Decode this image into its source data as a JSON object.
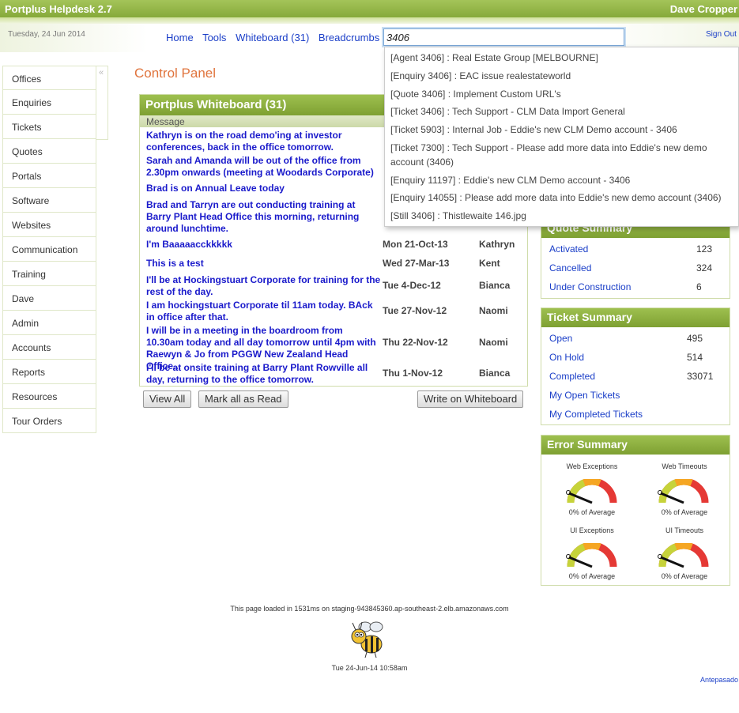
{
  "app": {
    "title": "Portplus Helpdesk 2.7",
    "user": "Dave Cropper",
    "date": "Tuesday, 24 Jun 2014",
    "sign_out": "Sign Out"
  },
  "nav": {
    "home": "Home",
    "tools": "Tools",
    "whiteboard": "Whiteboard (31)",
    "breadcrumbs": "Breadcrumbs"
  },
  "search": {
    "value": "3406"
  },
  "dropdown": [
    "[Agent 3406] : Real Estate Group [MELBOURNE]",
    "[Enquiry 3406] : EAC issue realestateworld",
    "[Quote 3406] : Implement Custom URL's",
    "[Ticket 3406] : Tech Support - CLM Data Import General",
    "[Ticket 5903] : Internal Job - Eddie's new CLM Demo account - 3406",
    "[Ticket 7300] : Tech Support - Please add more data into Eddie's new demo account (3406)",
    "[Enquiry 11197] : Eddie's new CLM Demo account - 3406",
    "[Enquiry 14055] : Please add more data into Eddie's new demo account (3406)",
    "[Still 3406] : Thistlewaite 146.jpg"
  ],
  "sidebar": [
    "Offices",
    "Enquiries",
    "Tickets",
    "Quotes",
    "Portals",
    "Software",
    "Websites",
    "Communication",
    "Training",
    "Dave",
    "Admin",
    "Accounts",
    "Reports",
    "Resources",
    "Tour Orders"
  ],
  "sidebar_toggle": "«",
  "control_panel_title": "Control Panel",
  "whiteboard": {
    "title": "Portplus Whiteboard (31)",
    "col_message": "Message",
    "rows": [
      {
        "msg": "Kathryn is on the road demo'ing at investor conferences, back in the office tomorrow.",
        "date": "",
        "who": ""
      },
      {
        "msg": "Sarah and Amanda will be out of the office from 2.30pm onwards (meeting at Woodards Corporate)",
        "date": "",
        "who": ""
      },
      {
        "msg": "Brad is on Annual Leave today",
        "date": "",
        "who": ""
      },
      {
        "msg": "Brad and Tarryn are out conducting training at Barry Plant Head Office this morning, returning around lunchtime.",
        "date": "",
        "who": ""
      },
      {
        "msg": "I'm Baaaaacckkkkk",
        "date": "Mon 21-Oct-13",
        "who": "Kathryn"
      },
      {
        "msg": "This is a test",
        "date": "Wed 27-Mar-13",
        "who": "Kent"
      },
      {
        "msg": "I'll be at Hockingstuart Corporate for training for the rest of the day.",
        "date": "Tue 4-Dec-12",
        "who": "Bianca"
      },
      {
        "msg": "I am hockingstuart Corporate til 11am today. BAck in office after that.",
        "date": "Tue 27-Nov-12",
        "who": "Naomi"
      },
      {
        "msg": "I will be in a meeting in the boardroom from 10.30am today and all day tomorrow until 4pm with Raewyn & Jo from PGGW New Zealand Head Office...",
        "date": "Thu 22-Nov-12",
        "who": "Naomi"
      },
      {
        "msg": "I'll be at onsite training at Barry Plant Rowville all day, returning to the office tomorrow.",
        "date": "Thu 1-Nov-12",
        "who": "Bianca"
      }
    ],
    "view_all": "View All",
    "mark_read": "Mark all as Read",
    "write": "Write on Whiteboard"
  },
  "quote_summary": {
    "title": "Quote Summary",
    "rows": [
      {
        "label": "Activated",
        "value": "123"
      },
      {
        "label": "Cancelled",
        "value": "324"
      },
      {
        "label": "Under Construction",
        "value": "6"
      }
    ]
  },
  "ticket_summary": {
    "title": "Ticket Summary",
    "rows": [
      {
        "label": "Open",
        "value": "495"
      },
      {
        "label": "On Hold",
        "value": "514"
      },
      {
        "label": "Completed",
        "value": "33071"
      }
    ],
    "links": [
      "My Open Tickets",
      "My Completed Tickets"
    ]
  },
  "error_summary": {
    "title": "Error Summary",
    "gauges": [
      {
        "label": "Web Exceptions",
        "caption": "0% of Average",
        "percent": 0
      },
      {
        "label": "Web Timeouts",
        "caption": "0% of Average",
        "percent": 0
      },
      {
        "label": "UI Exceptions",
        "caption": "0% of Average",
        "percent": 0
      },
      {
        "label": "UI Timeouts",
        "caption": "0% of Average",
        "percent": 0
      }
    ]
  },
  "footer": {
    "loaded": "This page loaded in 1531ms on staging-943845360.ap-southeast-2.elb.amazonaws.com",
    "timestamp": "Tue 24-Jun-14 10:58am",
    "link": "Antepasado"
  }
}
